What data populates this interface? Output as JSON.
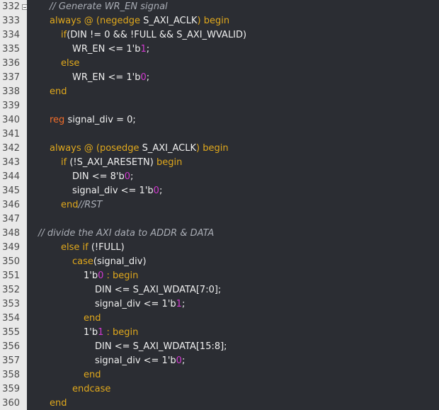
{
  "editor": {
    "first_line_number": 332,
    "fold_marker_line": 332,
    "colors": {
      "background": "#2b2d33",
      "gutter": "#e9e9e9",
      "text": "#f0f0f0",
      "keyword": "#e0a81c",
      "type": "#f26d2a",
      "comment": "#a9adb5",
      "highlight": "#d23ad1"
    },
    "lines": [
      {
        "n": "332",
        "indent": 2,
        "tokens": [
          {
            "t": "// Generate WR_EN signal",
            "c": "cm"
          }
        ]
      },
      {
        "n": "333",
        "indent": 2,
        "tokens": [
          {
            "t": "always @ (negedge ",
            "c": "kw"
          },
          {
            "t": "S_AXI_ACLK",
            "c": "tx"
          },
          {
            "t": ") begin",
            "c": "kw"
          }
        ]
      },
      {
        "n": "334",
        "indent": 3,
        "tokens": [
          {
            "t": "if",
            "c": "kw"
          },
          {
            "t": "(DIN != 0 && !FULL && S_AXI_WVALID)",
            "c": "tx"
          }
        ]
      },
      {
        "n": "335",
        "indent": 4,
        "tokens": [
          {
            "t": "WR_EN <= 1'b",
            "c": "tx"
          },
          {
            "t": "1",
            "c": "hl"
          },
          {
            "t": ";",
            "c": "tx"
          }
        ]
      },
      {
        "n": "336",
        "indent": 3,
        "tokens": [
          {
            "t": "else",
            "c": "kw"
          }
        ]
      },
      {
        "n": "337",
        "indent": 4,
        "tokens": [
          {
            "t": "WR_EN <= 1'b",
            "c": "tx"
          },
          {
            "t": "0",
            "c": "hl"
          },
          {
            "t": ";",
            "c": "tx"
          }
        ]
      },
      {
        "n": "338",
        "indent": 2,
        "tokens": [
          {
            "t": "end",
            "c": "kw"
          }
        ]
      },
      {
        "n": "339",
        "indent": 0,
        "tokens": []
      },
      {
        "n": "340",
        "indent": 2,
        "tokens": [
          {
            "t": "reg",
            "c": "ty"
          },
          {
            "t": " signal_div = 0;",
            "c": "tx"
          }
        ]
      },
      {
        "n": "341",
        "indent": 0,
        "tokens": []
      },
      {
        "n": "342",
        "indent": 2,
        "tokens": [
          {
            "t": "always @ (posedge ",
            "c": "kw"
          },
          {
            "t": "S_AXI_ACLK",
            "c": "tx"
          },
          {
            "t": ") begin",
            "c": "kw"
          }
        ]
      },
      {
        "n": "343",
        "indent": 3,
        "tokens": [
          {
            "t": "if ",
            "c": "kw"
          },
          {
            "t": "(!S_AXI_ARESETN)",
            "c": "tx"
          },
          {
            "t": " begin",
            "c": "kw"
          }
        ]
      },
      {
        "n": "344",
        "indent": 4,
        "tokens": [
          {
            "t": "DIN <= 8'b",
            "c": "tx"
          },
          {
            "t": "0",
            "c": "hl"
          },
          {
            "t": ";",
            "c": "tx"
          }
        ]
      },
      {
        "n": "345",
        "indent": 4,
        "tokens": [
          {
            "t": "signal_div <= 1'b",
            "c": "tx"
          },
          {
            "t": "0",
            "c": "hl"
          },
          {
            "t": ";",
            "c": "tx"
          }
        ]
      },
      {
        "n": "346",
        "indent": 3,
        "tokens": [
          {
            "t": "end",
            "c": "kw"
          },
          {
            "t": "//RST",
            "c": "cm"
          }
        ]
      },
      {
        "n": "347",
        "indent": 0,
        "tokens": []
      },
      {
        "n": "348",
        "indent": 1,
        "tokens": [
          {
            "t": "// divide the AXI data to ADDR & DATA",
            "c": "cm"
          }
        ]
      },
      {
        "n": "349",
        "indent": 3,
        "tokens": [
          {
            "t": "else if ",
            "c": "kw"
          },
          {
            "t": "(!FULL)",
            "c": "tx"
          }
        ]
      },
      {
        "n": "350",
        "indent": 4,
        "tokens": [
          {
            "t": "case",
            "c": "kw"
          },
          {
            "t": "(signal_div)",
            "c": "tx"
          }
        ]
      },
      {
        "n": "351",
        "indent": 5,
        "tokens": [
          {
            "t": "1'b",
            "c": "tx"
          },
          {
            "t": "0",
            "c": "hl"
          },
          {
            "t": " : begin",
            "c": "kw"
          }
        ]
      },
      {
        "n": "352",
        "indent": 6,
        "tokens": [
          {
            "t": "DIN <= S_AXI_WDATA[7:0];",
            "c": "tx"
          }
        ]
      },
      {
        "n": "353",
        "indent": 6,
        "tokens": [
          {
            "t": "signal_div <= 1'b",
            "c": "tx"
          },
          {
            "t": "1",
            "c": "hl"
          },
          {
            "t": ";",
            "c": "tx"
          }
        ]
      },
      {
        "n": "354",
        "indent": 5,
        "tokens": [
          {
            "t": "end",
            "c": "kw"
          }
        ]
      },
      {
        "n": "355",
        "indent": 5,
        "tokens": [
          {
            "t": "1'b",
            "c": "tx"
          },
          {
            "t": "1",
            "c": "hl"
          },
          {
            "t": " : begin",
            "c": "kw"
          }
        ]
      },
      {
        "n": "356",
        "indent": 6,
        "tokens": [
          {
            "t": "DIN <= S_AXI_WDATA[15:8];",
            "c": "tx"
          }
        ]
      },
      {
        "n": "357",
        "indent": 6,
        "tokens": [
          {
            "t": "signal_div <= 1'b",
            "c": "tx"
          },
          {
            "t": "0",
            "c": "hl"
          },
          {
            "t": ";",
            "c": "tx"
          }
        ]
      },
      {
        "n": "358",
        "indent": 5,
        "tokens": [
          {
            "t": "end",
            "c": "kw"
          }
        ]
      },
      {
        "n": "359",
        "indent": 4,
        "tokens": [
          {
            "t": "endcase",
            "c": "kw"
          }
        ]
      },
      {
        "n": "360",
        "indent": 2,
        "tokens": [
          {
            "t": "end",
            "c": "kw"
          }
        ]
      }
    ]
  }
}
